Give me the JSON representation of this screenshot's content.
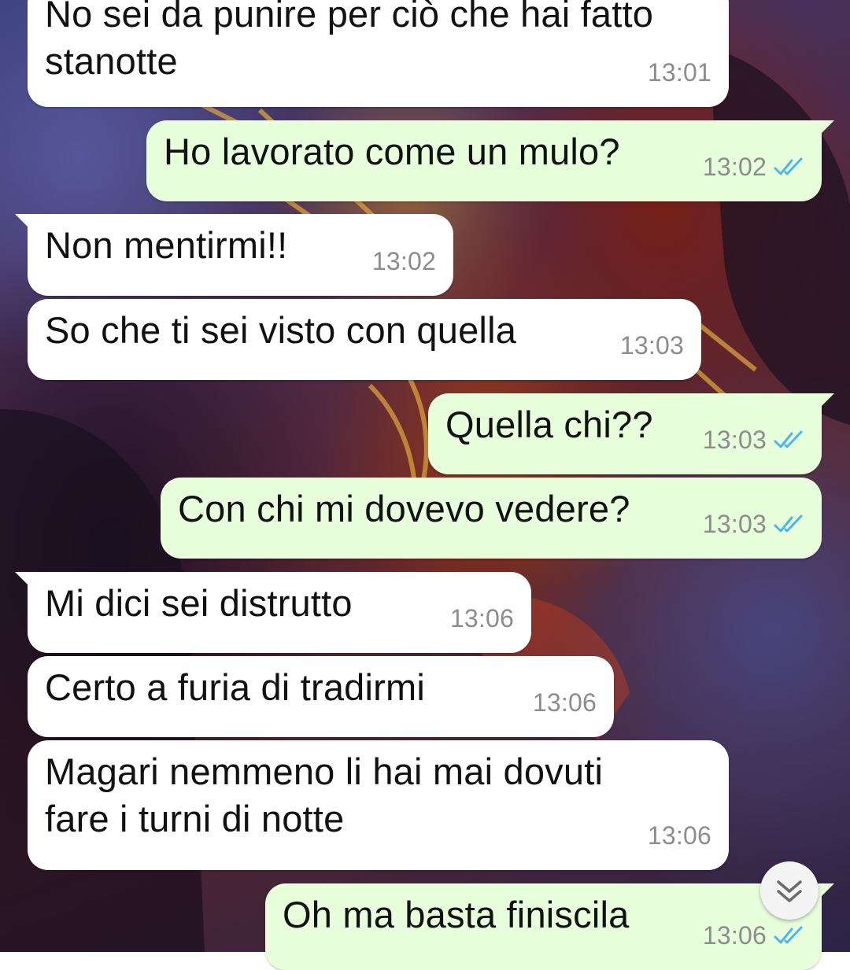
{
  "messages": [
    {
      "dir": "in",
      "text": "No sei da punire per ciò che hai fatto stanotte",
      "time": "13:01",
      "ticks": false
    },
    {
      "dir": "out",
      "text": "Ho lavorato come un mulo?",
      "time": "13:02",
      "ticks": true
    },
    {
      "dir": "in",
      "text": "Non mentirmi!!",
      "time": "13:02",
      "ticks": false
    },
    {
      "dir": "in",
      "text": "So che ti sei visto con quella",
      "time": "13:03",
      "ticks": false
    },
    {
      "dir": "out",
      "text": "Quella chi??",
      "time": "13:03",
      "ticks": true
    },
    {
      "dir": "out",
      "text": "Con chi mi dovevo vedere?",
      "time": "13:03",
      "ticks": true
    },
    {
      "dir": "in",
      "text": "Mi dici sei distrutto",
      "time": "13:06",
      "ticks": false
    },
    {
      "dir": "in",
      "text": "Certo a furia di tradirmi",
      "time": "13:06",
      "ticks": false
    },
    {
      "dir": "in",
      "text": "Magari nemmeno li hai mai dovuti fare i turni di notte",
      "time": "13:06",
      "ticks": false
    },
    {
      "dir": "out",
      "text": "Oh ma basta finiscila",
      "time": "13:06",
      "ticks": true
    }
  ],
  "line_breaks": {
    "0": [
      "No sei da punire per ciò che hai fatto",
      "stanotte"
    ],
    "8": [
      "Magari nemmeno li hai mai dovuti",
      "fare i turni di notte"
    ]
  },
  "icons": {
    "read_receipt": "double-check-icon",
    "scroll_down": "chevron-double-down-icon"
  },
  "colors": {
    "incoming_bubble": "#ffffff",
    "outgoing_bubble": "#e7ffdb",
    "read_tick": "#4fb6ec",
    "timestamp": "#8c8c8c"
  }
}
